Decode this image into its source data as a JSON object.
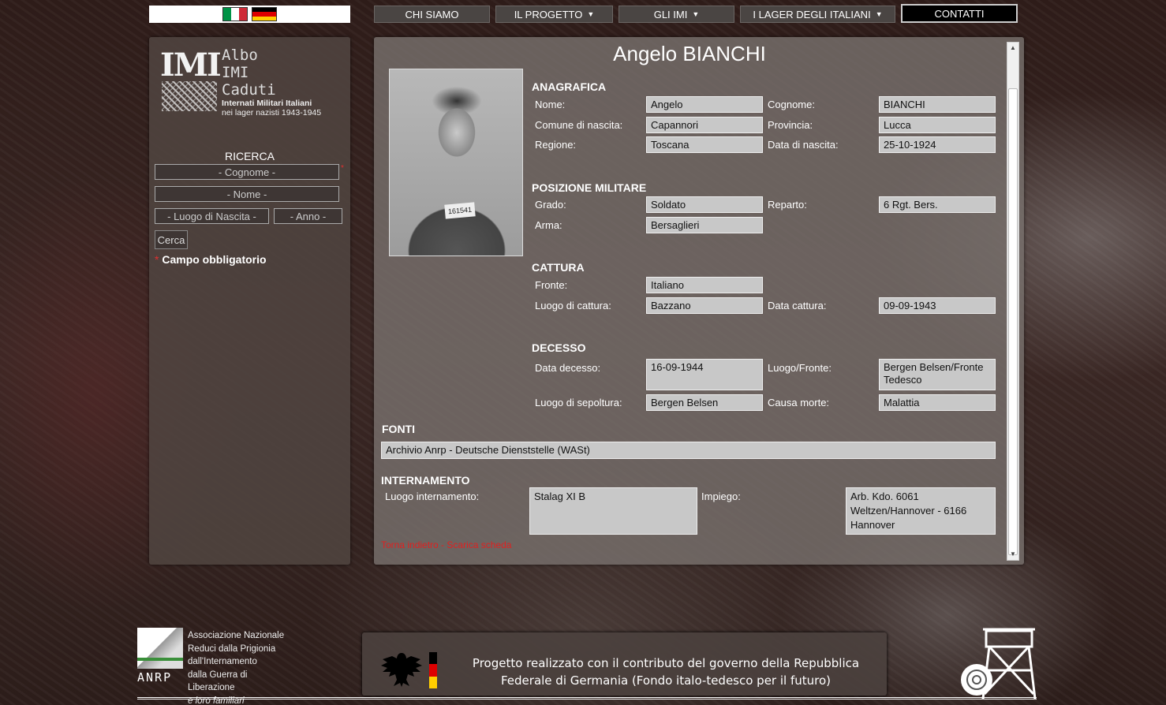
{
  "nav": {
    "flags": [
      {
        "name": "italian-flag-icon",
        "colors": [
          "#009246",
          "#ffffff",
          "#ce2b37"
        ]
      },
      {
        "name": "german-flag-icon",
        "colors": [
          "#000000",
          "#dd0000",
          "#ffce00"
        ]
      }
    ],
    "chi_siamo": "CHI SIAMO",
    "il_progetto": "IL PROGETTO",
    "gli_imi": "GLI IMI",
    "lager": "I LAGER DEGLI ITALIANI",
    "contatti": "CONTATTI"
  },
  "logo": {
    "imi": "IMI",
    "albo": "Albo",
    "imi_small": "IMI",
    "caduti": "Caduti",
    "subtitle_1": "Internati Militari Italiani",
    "subtitle_2": "nei lager nazisti 1943-1945"
  },
  "search": {
    "title": "RICERCA",
    "cognome_placeholder": "- Cognome -",
    "nome_placeholder": "- Nome -",
    "luogo_placeholder": "- Luogo di Nascita -",
    "anno_placeholder": "- Anno -",
    "cerca_label": "Cerca",
    "required_star": "*",
    "required_note": "Campo obbligatorio"
  },
  "record": {
    "name": "Angelo BIANCHI",
    "photo_tag": "161541",
    "anagrafica": {
      "title": "ANAGRAFICA",
      "nome_label": "Nome:",
      "nome": "Angelo",
      "cognome_label": "Cognome:",
      "cognome": "BIANCHI",
      "comune_label": "Comune di nascita:",
      "comune": "Capannori",
      "provincia_label": "Provincia:",
      "provincia": "Lucca",
      "regione_label": "Regione:",
      "regione": "Toscana",
      "data_nascita_label": "Data di nascita:",
      "data_nascita": "25-10-1924"
    },
    "militare": {
      "title": "POSIZIONE MILITARE",
      "grado_label": "Grado:",
      "grado": "Soldato",
      "reparto_label": "Reparto:",
      "reparto": "6 Rgt. Bers.",
      "arma_label": "Arma:",
      "arma": "Bersaglieri"
    },
    "cattura": {
      "title": "CATTURA",
      "fronte_label": "Fronte:",
      "fronte": "Italiano",
      "luogo_label": "Luogo di cattura:",
      "luogo": "Bazzano",
      "data_label": "Data cattura:",
      "data": "09-09-1943"
    },
    "decesso": {
      "title": "DECESSO",
      "data_label": "Data decesso:",
      "data": "16-09-1944",
      "luogo_label": "Luogo/Fronte:",
      "luogo": "Bergen Belsen/Fronte Tedesco",
      "sepoltura_label": "Luogo di sepoltura:",
      "sepoltura": "Bergen Belsen",
      "causa_label": "Causa morte:",
      "causa": "Malattia"
    },
    "fonti": {
      "title": "FONTI",
      "value": "Archivio Anrp - Deutsche Dienststelle (WASt)"
    },
    "internamento": {
      "title": "INTERNAMENTO",
      "luogo_label": "Luogo internamento:",
      "luogo": "Stalag XI B",
      "impiego_label": "Impiego:",
      "impiego": "Arb. Kdo. 6061 Weltzen/Hannover - 6166 Hannover"
    },
    "links": {
      "back": "Torna indietro",
      "sep": " - ",
      "download": "Scarica scheda"
    }
  },
  "footer": {
    "anrp_acronym": "ANRP",
    "anrp_lines": [
      "Associazione Nazionale",
      "Reduci dalla Prigionia",
      "dall'Internamento",
      "dalla Guerra di Liberazione",
      "e loro familiari"
    ],
    "project_line_1": "Progetto realizzato con il contributo del governo della Repubblica",
    "project_line_2": "Federale di Germania (Fondo italo-tedesco per il futuro)"
  },
  "colors": {
    "accent_red": "#e02020",
    "field_bg": "#c8c8c8",
    "nav_bg": "#4a4543"
  }
}
